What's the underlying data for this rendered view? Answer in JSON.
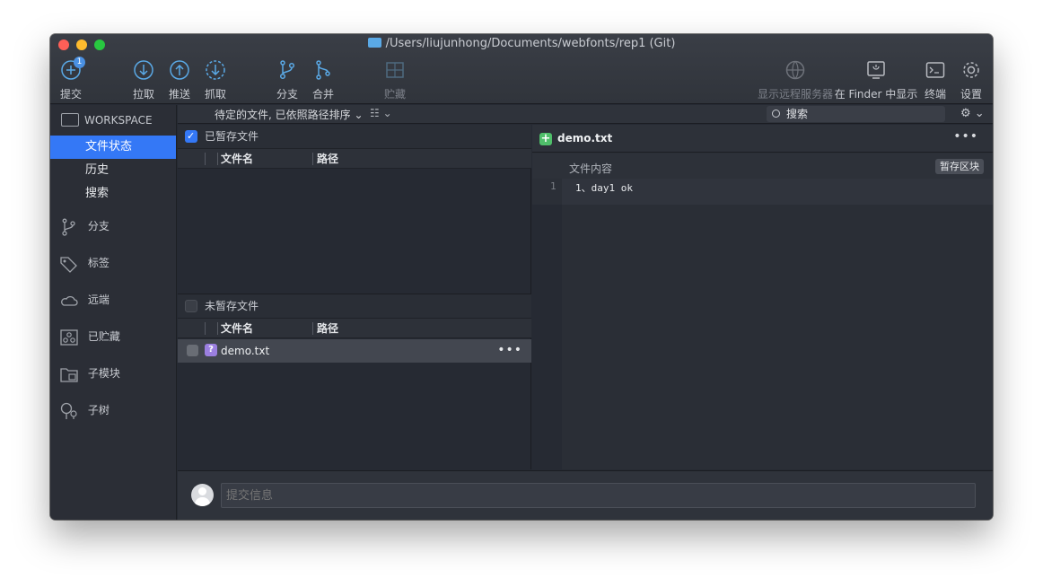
{
  "window": {
    "title": "/Users/liujunhong/Documents/webfonts/rep1 (Git)"
  },
  "toolbar": {
    "commit": {
      "label": "提交",
      "badge": "1"
    },
    "pull": "拉取",
    "push": "推送",
    "fetch": "抓取",
    "branch": "分支",
    "merge": "合并",
    "stash": "贮藏",
    "show_remote": "显示远程服务器",
    "show_in_finder": "在 Finder 中显示",
    "terminal": "终端",
    "settings": "设置"
  },
  "sidebar": {
    "workspace": "WORKSPACE",
    "items": [
      {
        "label": "文件状态"
      },
      {
        "label": "历史"
      },
      {
        "label": "搜索"
      }
    ],
    "groups": [
      {
        "label": "分支"
      },
      {
        "label": "标签"
      },
      {
        "label": "远端"
      },
      {
        "label": "已贮藏"
      },
      {
        "label": "子模块"
      },
      {
        "label": "子树"
      }
    ]
  },
  "filter": {
    "sort_label": "待定的文件, 已依照路径排序",
    "search_placeholder": "搜索"
  },
  "staged": {
    "title": "已暂存文件",
    "columns": [
      "文件名",
      "路径"
    ]
  },
  "unstaged": {
    "title": "未暂存文件",
    "columns": [
      "文件名",
      "路径"
    ],
    "files": [
      {
        "name": "demo.txt"
      }
    ]
  },
  "diff": {
    "file": "demo.txt",
    "content_label": "文件内容",
    "stage_button": "暂存区块",
    "lines": [
      {
        "num": "1",
        "text": "1、day1 ok"
      }
    ]
  },
  "commit": {
    "placeholder": "提交信息"
  },
  "colors": {
    "accent": "#3478f6",
    "added": "#4fbf6a",
    "untracked": "#9b7fe0"
  }
}
